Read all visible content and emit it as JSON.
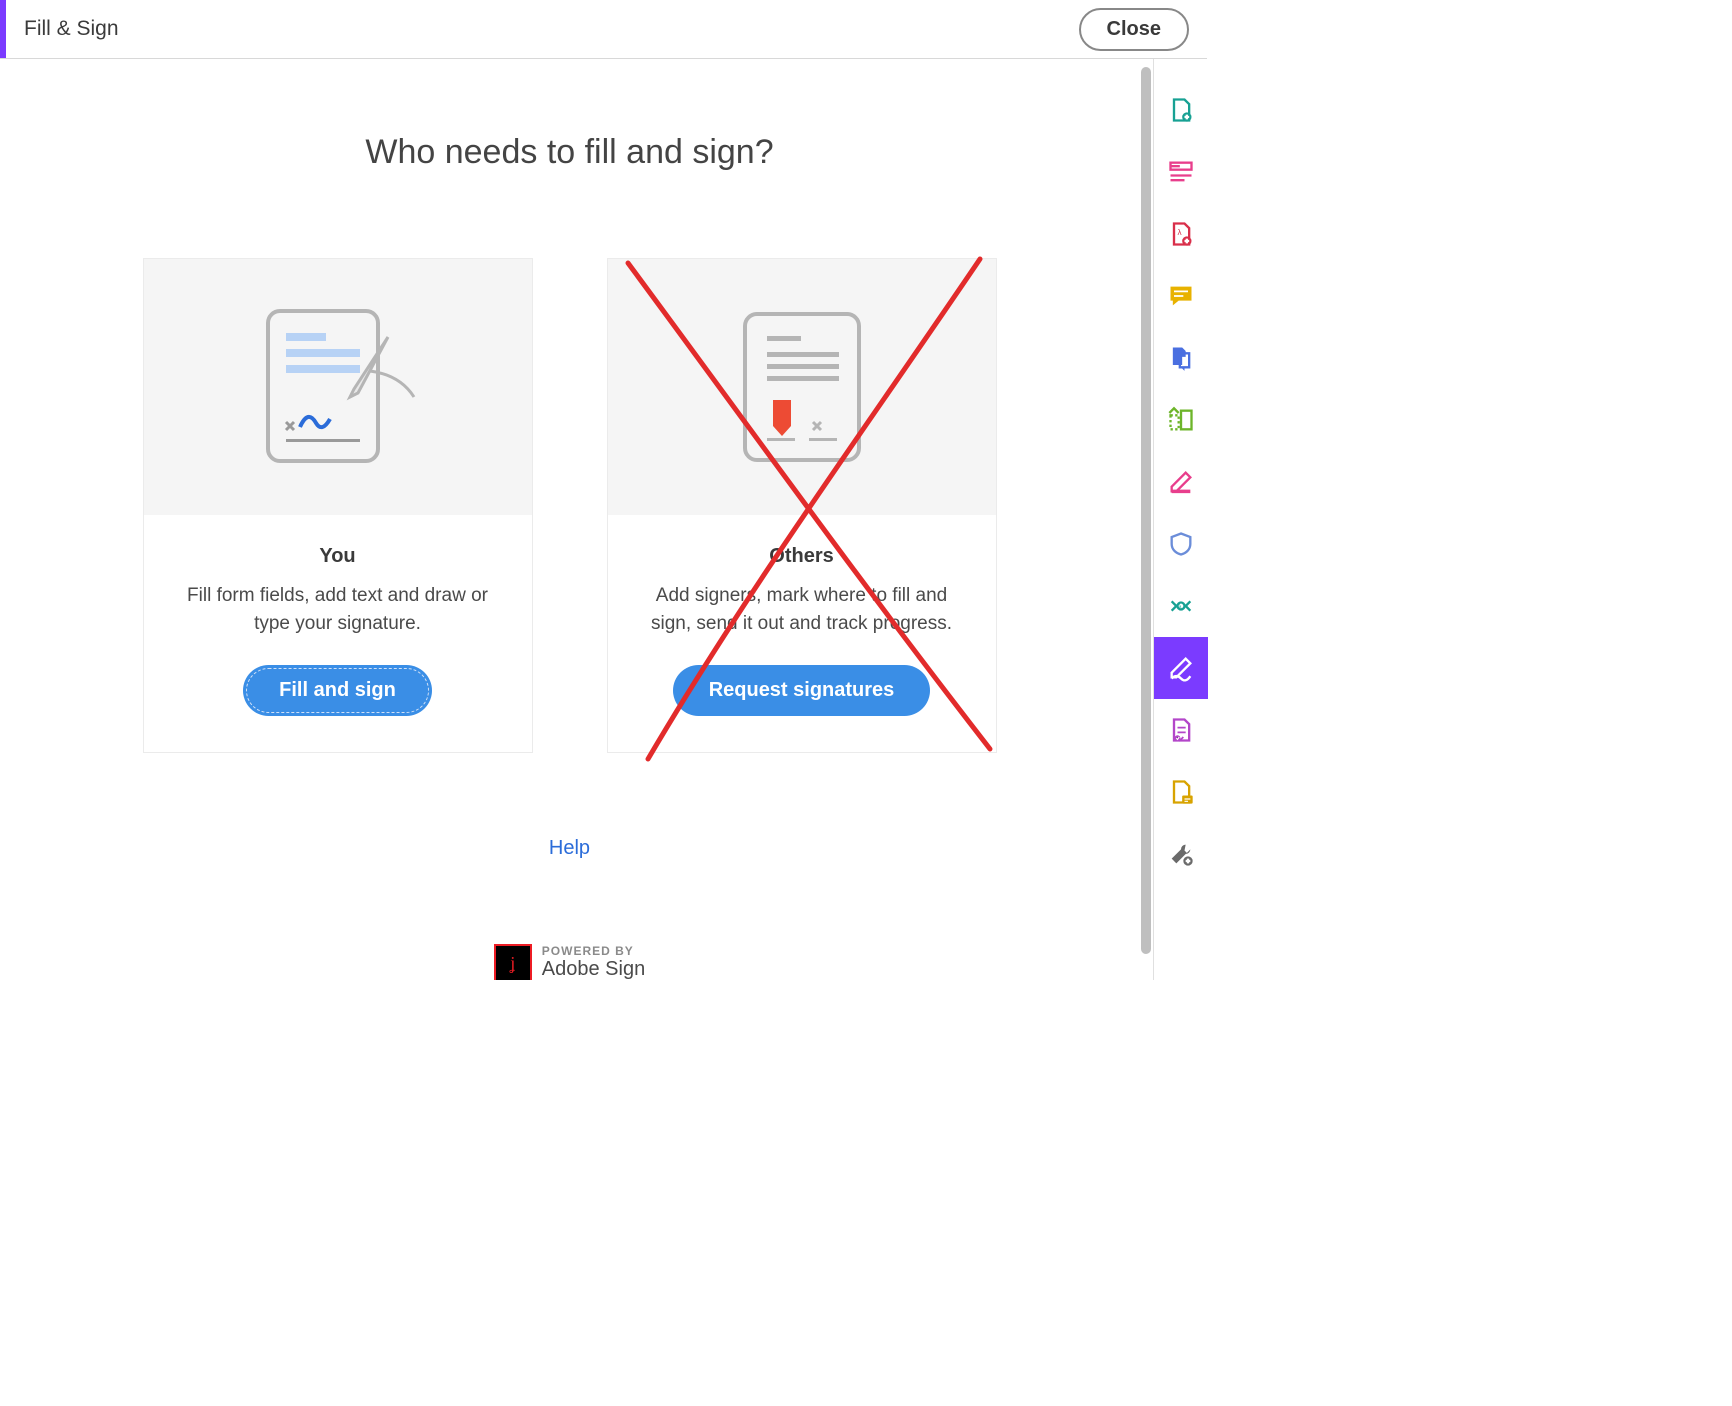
{
  "header": {
    "title": "Fill & Sign",
    "close_label": "Close"
  },
  "main": {
    "heading": "Who needs to fill and sign?",
    "help_label": "Help",
    "powered_label": "POWERED BY",
    "powered_brand": "Adobe Sign"
  },
  "cards": {
    "you": {
      "title": "You",
      "desc": "Fill form fields, add text and draw or type your signature.",
      "button": "Fill and sign"
    },
    "others": {
      "title": "Others",
      "desc": "Add signers, mark where to fill and sign, send it out and track progress.",
      "button": "Request signatures"
    }
  },
  "right_rail": {
    "items": [
      {
        "name": "export-pdf-icon"
      },
      {
        "name": "edit-pdf-icon"
      },
      {
        "name": "create-pdf-icon"
      },
      {
        "name": "comment-icon"
      },
      {
        "name": "combine-files-icon"
      },
      {
        "name": "organize-pages-icon"
      },
      {
        "name": "redact-icon"
      },
      {
        "name": "protect-icon"
      },
      {
        "name": "compress-icon"
      },
      {
        "name": "fill-sign-icon"
      },
      {
        "name": "prepare-form-icon"
      },
      {
        "name": "send-for-comments-icon"
      },
      {
        "name": "more-tools-icon"
      }
    ],
    "active_index": 9
  },
  "annotation": {
    "type": "cross-out",
    "target": "others-card",
    "color": "#e22b2b"
  }
}
